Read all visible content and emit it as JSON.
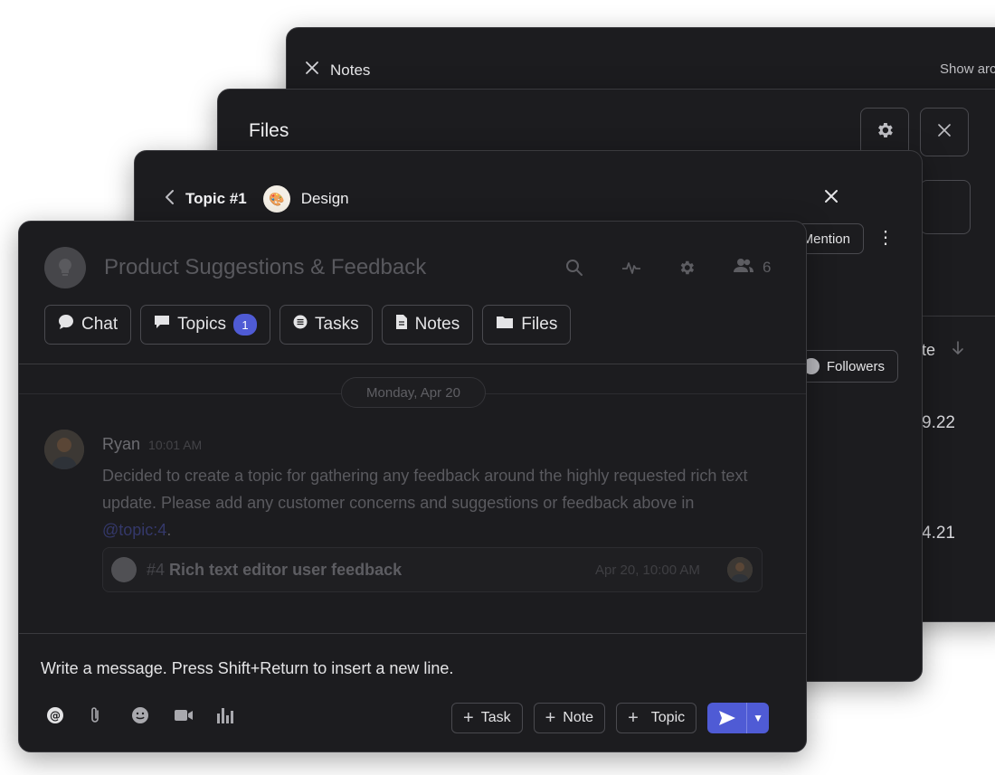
{
  "notes_panel": {
    "title": "Notes",
    "right_text": "Show arc"
  },
  "files_panel": {
    "title": "Files",
    "col_header": "te",
    "value1": "9.22",
    "value2": "4.21"
  },
  "topic_panel": {
    "back_label": "Topic #1",
    "design_label": "Design",
    "mention_label": "Mention",
    "followers_label": "Followers"
  },
  "main": {
    "title": "Product Suggestions & Feedback",
    "member_count": "6",
    "tabs": [
      {
        "label": "Chat"
      },
      {
        "label": "Topics",
        "badge": "1"
      },
      {
        "label": "Tasks"
      },
      {
        "label": "Notes"
      },
      {
        "label": "Files"
      }
    ],
    "date": "Monday, Apr 20",
    "message": {
      "author": "Ryan",
      "time": "10:01 AM",
      "text_before": "Decided to create a topic for gathering any feedback around the highly requested rich text update. Please add any customer concerns and suggestions or feedback above in ",
      "mention": "@topic:4",
      "text_after": "."
    },
    "reference": {
      "number": "#4",
      "title": "Rich text editor user feedback",
      "time": "Apr 20,  10:00 AM"
    },
    "composer": {
      "placeholder": "Write a message. Press Shift+Return to insert a new line.",
      "task_label": "Task",
      "note_label": "Note",
      "topic_label": "Topic"
    },
    "accent": "#4f5bd5"
  }
}
